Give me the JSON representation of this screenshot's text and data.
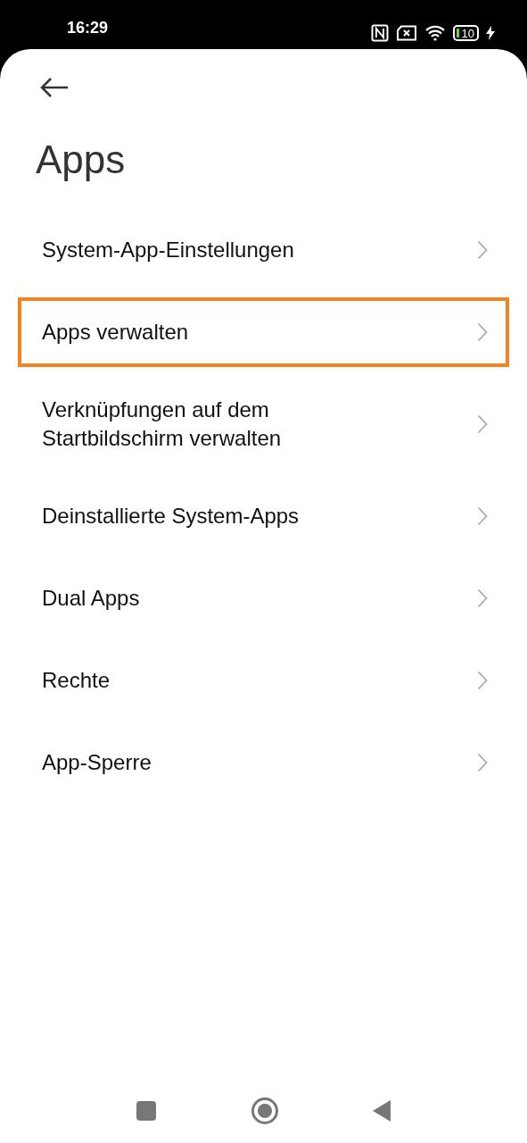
{
  "status_bar": {
    "time": "16:29",
    "battery": "10"
  },
  "title": "Apps",
  "items": [
    {
      "label": "System-App-Einstellungen",
      "highlighted": false
    },
    {
      "label": "Apps verwalten",
      "highlighted": true
    },
    {
      "label": "Verknüpfungen auf dem Startbildschirm verwalten",
      "highlighted": false
    },
    {
      "label": "Deinstallierte System-Apps",
      "highlighted": false
    },
    {
      "label": "Dual Apps",
      "highlighted": false
    },
    {
      "label": "Rechte",
      "highlighted": false
    },
    {
      "label": "App-Sperre",
      "highlighted": false
    }
  ]
}
